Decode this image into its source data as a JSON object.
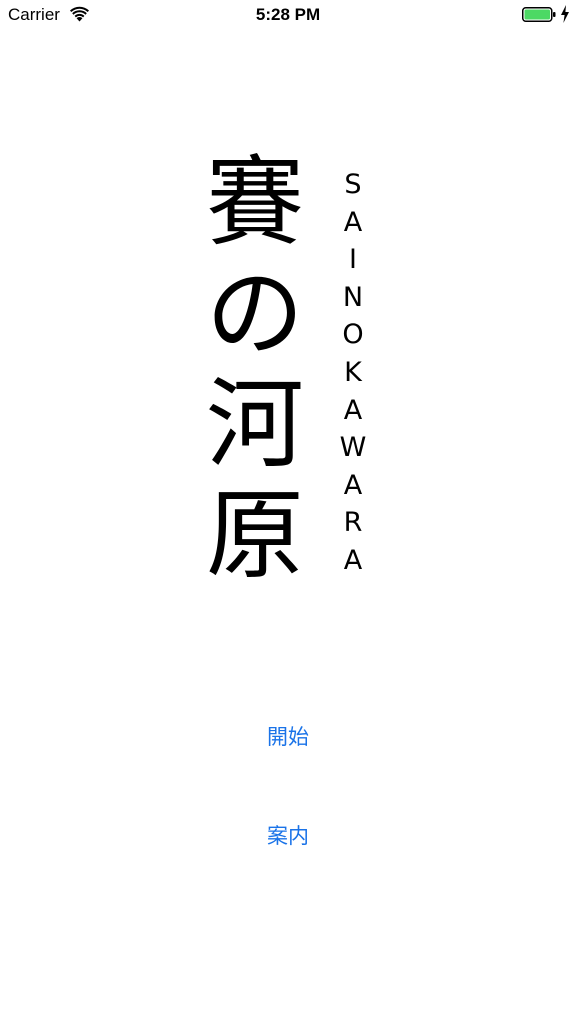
{
  "status_bar": {
    "carrier": "Carrier",
    "time": "5:28 PM",
    "battery_level": 1.0,
    "battery_color": "#4cd964",
    "wifi_icon": "wifi-icon",
    "charging_icon": "bolt-icon"
  },
  "title": {
    "kanji": [
      "賽",
      "の",
      "河",
      "原"
    ],
    "romaji": [
      "S",
      "A",
      "I",
      "N",
      "O",
      "K",
      "A",
      "W",
      "A",
      "R",
      "A"
    ]
  },
  "menu": {
    "start_label": "開始",
    "guide_label": "案内",
    "link_color": "#1a73e8"
  }
}
